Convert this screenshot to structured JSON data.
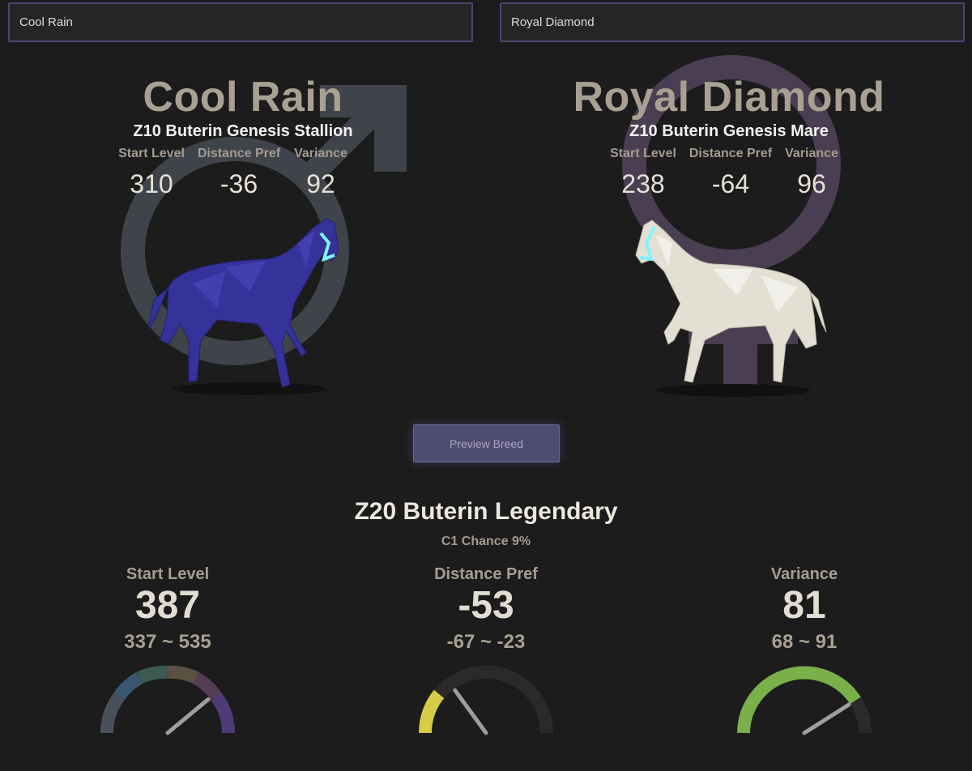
{
  "inputs": {
    "sire_value": "Cool Rain",
    "dam_value": "Royal Diamond"
  },
  "sire": {
    "name": "Cool Rain",
    "subtitle": "Z10 Buterin Genesis Stallion",
    "stats": [
      {
        "label": "Start Level",
        "value": "310"
      },
      {
        "label": "Distance Pref",
        "value": "-36"
      },
      {
        "label": "Variance",
        "value": "92"
      }
    ],
    "symbol_icon": "male-symbol-icon",
    "coat_color": "#3d3a9a"
  },
  "dam": {
    "name": "Royal Diamond",
    "subtitle": "Z10 Buterin Genesis Mare",
    "stats": [
      {
        "label": "Start Level",
        "value": "238"
      },
      {
        "label": "Distance Pref",
        "value": "-64"
      },
      {
        "label": "Variance",
        "value": "96"
      }
    ],
    "symbol_icon": "female-symbol-icon",
    "coat_color": "#e6e1d6"
  },
  "preview_button": "Preview Breed",
  "result": {
    "title": "Z20 Buterin Legendary",
    "chance": "C1 Chance 9%",
    "stats": [
      {
        "label": "Start Level",
        "value": "387",
        "range": "337 ~ 535",
        "needle_fraction": 0.78
      },
      {
        "label": "Distance Pref",
        "value": "-53",
        "range": "-67 ~ -23",
        "needle_fraction": 0.3,
        "fill_color": "#d6cc48"
      },
      {
        "label": "Variance",
        "value": "81",
        "range": "68 ~ 91",
        "needle_fraction": 0.82,
        "fill_color": "#7ab04a"
      }
    ]
  },
  "colors": {
    "accent": "#4b4570",
    "male_symbol": "#3f444a",
    "female_symbol": "#4a3e52",
    "halter": "#7ff4ff"
  }
}
